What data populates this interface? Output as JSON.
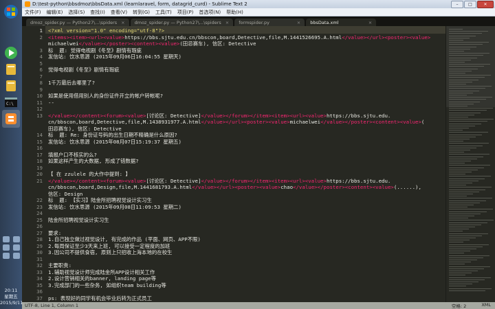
{
  "window": {
    "title": "D:\\test-python\\bbsdmoz\\bbsData.xml (learnlaravel, form, datagrid_curd) - Sublime Text 2",
    "buttons": [
      "–",
      "□",
      "✕"
    ]
  },
  "menu": [
    "文件(F)",
    "编辑(E)",
    "选择(S)",
    "查找(I)",
    "查看(V)",
    "转到(G)",
    "工具(T)",
    "项目(P)",
    "首选项(N)",
    "帮助(H)"
  ],
  "tabs": [
    {
      "label": "dmoz_spider.py — Python27\\...\\spiders",
      "active": false
    },
    {
      "label": "dmoz_spider.py — Python27\\...\\spiders",
      "active": false
    },
    {
      "label": "formspider.py",
      "active": false
    },
    {
      "label": "bbsData.xml",
      "active": true
    }
  ],
  "code_lines": [
    {
      "n": "1",
      "t": "<?xml version=\"1.0\" encoding=\"utf-8\"?>"
    },
    {
      "n": "2",
      "t": "<items><item><url><value>https://bbs.sjtu.edu.cn/bbscon,board,Detective,file,M.1441526695.A.html</value></url><poster><value>"
    },
    {
      "n": "",
      "t": "michaelwei</value></poster><content><value>(田忌赛车), 信区: Detective"
    },
    {
      "n": "3",
      "t": "标  题: 觉得电视剧《冬至》剧情有瑕疵"
    },
    {
      "n": "4",
      "t": "发信站: 饮水思源 (2015年09月06日16:04:55 星期天)"
    },
    {
      "n": "5",
      "t": ""
    },
    {
      "n": "6",
      "t": "觉得电视剧《冬至》剧情有瑕疵"
    },
    {
      "n": "7",
      "t": ""
    },
    {
      "n": "8",
      "t": "1千万最后去哪里了?"
    },
    {
      "n": "9",
      "t": ""
    },
    {
      "n": "10",
      "t": "如果是使用借用别人的身份证件开立的帐户转帐呢?"
    },
    {
      "n": "11",
      "t": "--"
    },
    {
      "n": "12",
      "t": ""
    },
    {
      "n": "13",
      "t": "</value></content><forum><value>[讨论区: Detective]</value></forum></item><item><url><value>https://bbs.sjtu.edu."
    },
    {
      "n": "",
      "t": "cn/bbscon,board,Detective,file,M.1438931977.A.html</value></url><poster><value>michaelwei</value></poster><content><value>("
    },
    {
      "n": "",
      "t": "田忌赛车), 信区: Detective"
    },
    {
      "n": "14",
      "t": "标  题: Re: 身份证号码的出生日期不精确是什么原因?"
    },
    {
      "n": "15",
      "t": "发信站: 饮水思源 (2015年08月07日15:19:37 星期五)"
    },
    {
      "n": "16",
      "t": ""
    },
    {
      "n": "17",
      "t": "填报户口不核实的么?"
    },
    {
      "n": "18",
      "t": "如果这样产生的大数据, 形成了错数据?"
    },
    {
      "n": "19",
      "t": ""
    },
    {
      "n": "20",
      "t": "【 在 zzulele 的大作中提到: 】"
    },
    {
      "n": "21",
      "t": "</value></content><forum><value>[讨论区: Detective]</value></forum></item><item><url><value>https://bbs.sjtu.edu."
    },
    {
      "n": "",
      "t": "cn/bbscon,board,Design,file,M.1441681793.A.html</value></url><poster><value>chao</value></poster><content><value>(......),"
    },
    {
      "n": "",
      "t": "信区: Design"
    },
    {
      "n": "22",
      "t": "标  题: 【实习】陆金所招聘视觉设计实习生"
    },
    {
      "n": "23",
      "t": "发信站: 饮水思源 (2015年09月08日11:09:53 星期二)"
    },
    {
      "n": "24",
      "t": ""
    },
    {
      "n": "25",
      "t": "陆金所招聘视觉设计实习生"
    },
    {
      "n": "26",
      "t": ""
    },
    {
      "n": "27",
      "t": "要求:"
    },
    {
      "n": "28",
      "t": "1.自己独立做过视觉设计, 有完成的作品 (平面、网页、APP不限)"
    },
    {
      "n": "29",
      "t": "2.每周保证至少3天来上班, 可以接受一定程度的加班"
    },
    {
      "n": "30",
      "t": "3.因公司不提供食宿, 原则上只招收上海本地的在校生"
    },
    {
      "n": "31",
      "t": ""
    },
    {
      "n": "32",
      "t": "主要职责:"
    },
    {
      "n": "33",
      "t": "1.辅助视觉设计师完成陆金所APP设计相关工作"
    },
    {
      "n": "34",
      "t": "2.设计营销相关的banner, landing page等"
    },
    {
      "n": "35",
      "t": "3.完成部门的一些杂务, 如组织team building等"
    },
    {
      "n": "36",
      "t": ""
    },
    {
      "n": "37",
      "t": "ps: 表现好的同学有机会毕业后转为正式员工"
    }
  ],
  "status": {
    "left": "UTF-8, Line 1, Column 1",
    "tab_size": "空格: 2",
    "syntax": "XML"
  },
  "clock": {
    "time": "20:11",
    "weekday": "星期五",
    "date": "2015/9/11"
  },
  "taskbar_icons": [
    "start-orb-icon",
    "media-icon",
    "folder-icon",
    "folder-icon",
    "terminal-icon",
    "sublime-icon"
  ],
  "colors": {
    "editor_bg": "#272822",
    "tag": "#f92672",
    "text": "#e8e8e2",
    "line_number": "#8f908a"
  }
}
